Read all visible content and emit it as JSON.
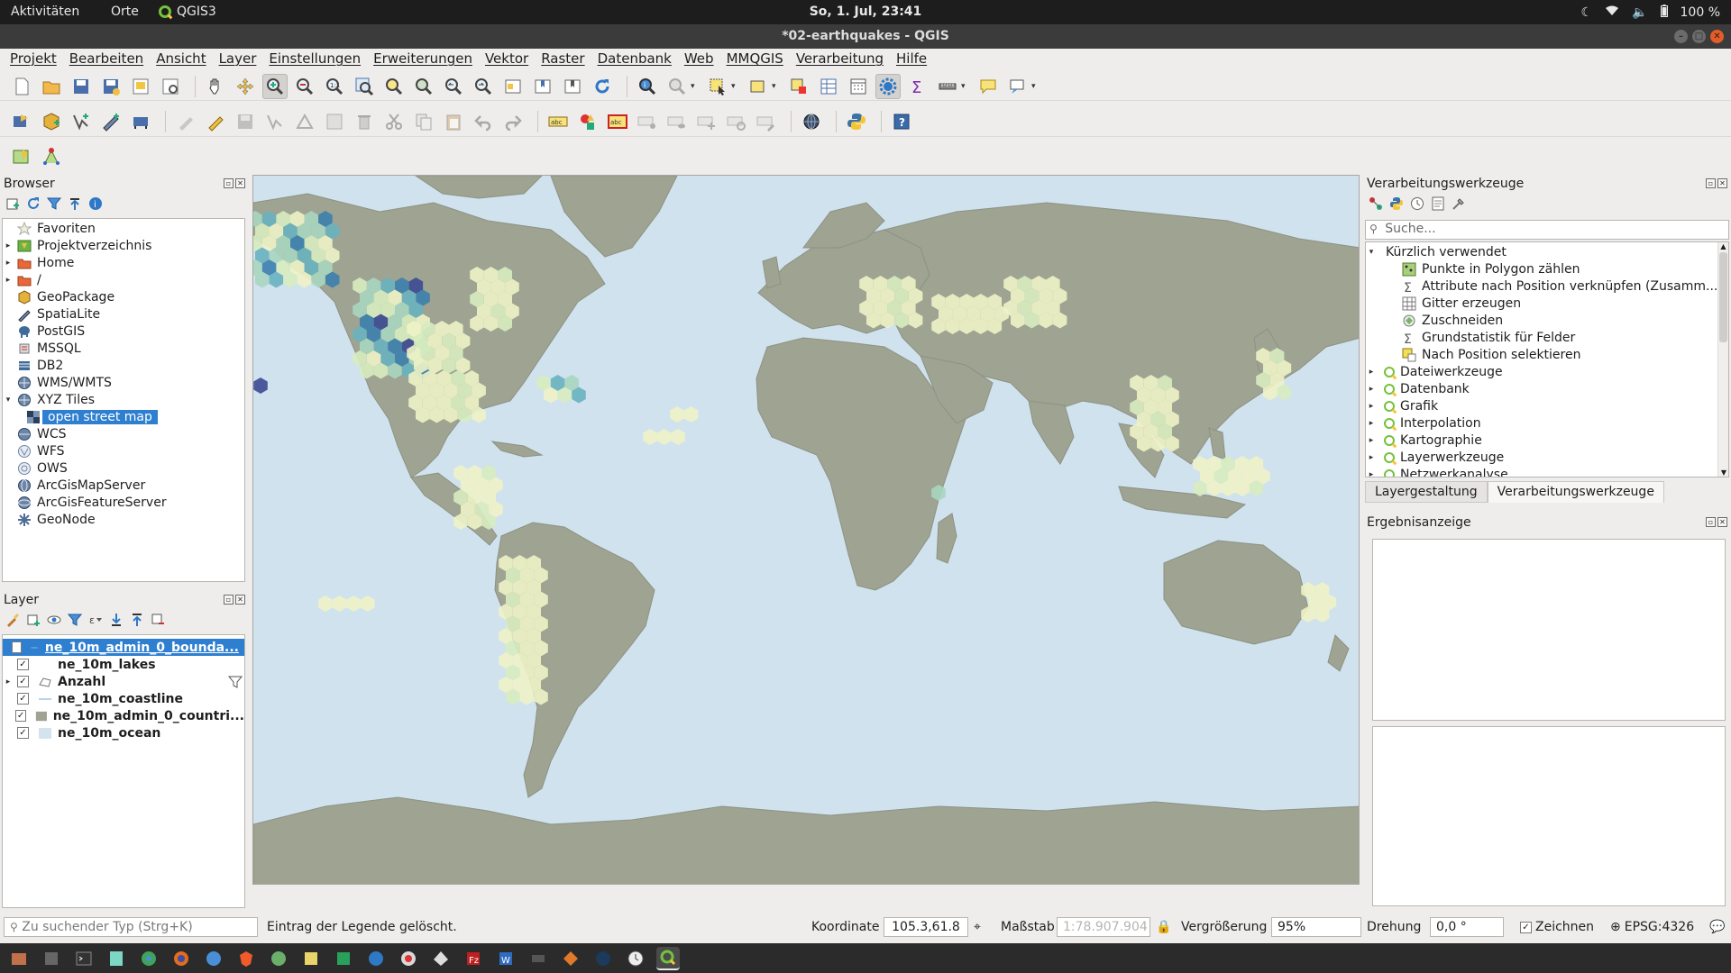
{
  "topbar": {
    "activities": "Aktivitäten",
    "places": "Orte",
    "app": "QGIS3",
    "clock": "So,  1. Jul, 23:41",
    "battery": "100 %"
  },
  "window": {
    "title": "*02-earthquakes - QGIS"
  },
  "menubar": [
    "Projekt",
    "Bearbeiten",
    "Ansicht",
    "Layer",
    "Einstellungen",
    "Erweiterungen",
    "Vektor",
    "Raster",
    "Datenbank",
    "Web",
    "MMQGIS",
    "Verarbeitung",
    "Hilfe"
  ],
  "browser": {
    "title": "Browser",
    "items": [
      {
        "label": "Favoriten",
        "icon": "star-icon",
        "expand": "",
        "indent": 0
      },
      {
        "label": "Projektverzeichnis",
        "icon": "project-folder-icon",
        "expand": "▸",
        "indent": 0
      },
      {
        "label": "Home",
        "icon": "home-folder-icon",
        "expand": "▸",
        "indent": 0
      },
      {
        "label": "/",
        "icon": "root-folder-icon",
        "expand": "▸",
        "indent": 0
      },
      {
        "label": "GeoPackage",
        "icon": "geopackage-icon",
        "expand": "",
        "indent": 0
      },
      {
        "label": "SpatiaLite",
        "icon": "spatialite-icon",
        "expand": "",
        "indent": 0
      },
      {
        "label": "PostGIS",
        "icon": "postgis-icon",
        "expand": "",
        "indent": 0
      },
      {
        "label": "MSSQL",
        "icon": "mssql-icon",
        "expand": "",
        "indent": 0
      },
      {
        "label": "DB2",
        "icon": "db2-icon",
        "expand": "",
        "indent": 0
      },
      {
        "label": "WMS/WMTS",
        "icon": "wms-icon",
        "expand": "",
        "indent": 0
      },
      {
        "label": "XYZ Tiles",
        "icon": "xyz-icon",
        "expand": "▾",
        "indent": 0
      },
      {
        "label": "open street map",
        "icon": "tile-layer-icon",
        "expand": "",
        "indent": 1,
        "selected": true
      },
      {
        "label": "WCS",
        "icon": "wcs-icon",
        "expand": "",
        "indent": 0
      },
      {
        "label": "WFS",
        "icon": "wfs-icon",
        "expand": "",
        "indent": 0
      },
      {
        "label": "OWS",
        "icon": "ows-icon",
        "expand": "",
        "indent": 0
      },
      {
        "label": "ArcGisMapServer",
        "icon": "arcgis-map-icon",
        "expand": "",
        "indent": 0
      },
      {
        "label": "ArcGisFeatureServer",
        "icon": "arcgis-feature-icon",
        "expand": "",
        "indent": 0
      },
      {
        "label": "GeoNode",
        "icon": "geonode-icon",
        "expand": "",
        "indent": 0
      }
    ]
  },
  "layers": {
    "title": "Layer",
    "items": [
      {
        "label": "ne_10m_admin_0_bounda...",
        "checked": "✓",
        "expand": "",
        "swatch": "line",
        "selected": true
      },
      {
        "label": "ne_10m_lakes",
        "checked": "✓",
        "expand": "",
        "swatch": "#ffffff"
      },
      {
        "label": "Anzahl",
        "checked": "✓",
        "expand": "▸",
        "swatch": "group",
        "filter": true
      },
      {
        "label": "ne_10m_coastline",
        "checked": "✓",
        "expand": "",
        "swatch": "line"
      },
      {
        "label": "ne_10m_admin_0_countri...",
        "checked": "✓",
        "expand": "",
        "swatch": "#9ea392"
      },
      {
        "label": "ne_10m_ocean",
        "checked": "✓",
        "expand": "",
        "swatch": "#d3e4ef"
      }
    ]
  },
  "processing": {
    "title": "Verarbeitungswerkzeuge",
    "search_placeholder": "Suche...",
    "recent_label": "Kürzlich verwendet",
    "recent": [
      {
        "label": "Punkte in Polygon zählen",
        "icon": "count-points-icon"
      },
      {
        "label": "Attribute nach Position verknüpfen (Zusamm...",
        "icon": "sigma-icon"
      },
      {
        "label": "Gitter erzeugen",
        "icon": "grid-icon"
      },
      {
        "label": "Zuschneiden",
        "icon": "clip-icon"
      },
      {
        "label": "Grundstatistik für Felder",
        "icon": "sigma-icon"
      },
      {
        "label": "Nach Position selektieren",
        "icon": "select-location-icon"
      }
    ],
    "groups": [
      "Dateiwerkzeuge",
      "Datenbank",
      "Grafik",
      "Interpolation",
      "Kartographie",
      "Layerwerkzeuge",
      "Netzwerkanalyse"
    ],
    "tabs": [
      "Layergestaltung",
      "Verarbeitungswerkzeuge"
    ],
    "active_tab": 1
  },
  "results": {
    "title": "Ergebnisanzeige"
  },
  "statusbar": {
    "locator_placeholder": "Zu suchender Typ (Strg+K)",
    "message": "Eintrag der Legende gelöscht.",
    "coord_label": "Koordinate",
    "coord_value": "105.3,61.8",
    "scale_label": "Maßstab",
    "scale_value": "1:78.907.904",
    "magnifier_label": "Vergrößerung",
    "magnifier_value": "95%",
    "rotation_label": "Drehung",
    "rotation_value": "0,0 °",
    "render_label": "Zeichnen",
    "crs": "EPSG:4326"
  },
  "map": {
    "ocean_color": "#cfe2ee",
    "land_color": "#9ea392",
    "hex_colors": [
      "#eef3c6",
      "#d7ecc0",
      "#a8d6c0",
      "#69b3bf",
      "#3b7fae",
      "#3c4a92"
    ]
  }
}
